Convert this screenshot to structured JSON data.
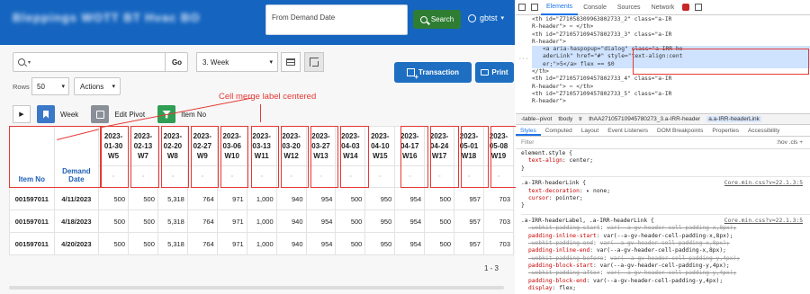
{
  "app": {
    "title": "Bleppings WOTT BT Hvac BO",
    "demand_input_placeholder": "From Demand Date",
    "search_label": "Search",
    "user_name": "gbtst"
  },
  "toolbar": {
    "go_label": "Go",
    "report_select_value": "3. Week",
    "transaction_label": "Transaction",
    "print_label": "Print",
    "rows_label": "Rows",
    "rows_value": "50",
    "actions_label": "Actions"
  },
  "annotation": "Cell merge label centered",
  "controls": {
    "week_label": "Week",
    "edit_pivot_label": "Edit Pivot",
    "item_no_label": "Item No"
  },
  "table": {
    "stub_headers": [
      "Item No",
      "Demand Date"
    ],
    "week_headers": [
      [
        "2023-",
        "01-30",
        "W5"
      ],
      [
        "2023-",
        "02-13",
        "W7"
      ],
      [
        "2023-",
        "02-20",
        "W8"
      ],
      [
        "2023-",
        "02-27",
        "W9"
      ],
      [
        "2023-",
        "03-06",
        "W10"
      ],
      [
        "2023-",
        "03-13",
        "W11"
      ],
      [
        "2023-",
        "03-20",
        "W12"
      ],
      [
        "2023-",
        "03-27",
        "W13"
      ],
      [
        "2023-",
        "04-03",
        "W14"
      ],
      [
        "2023-",
        "04-10",
        "W15"
      ],
      [
        "2023-",
        "04-17",
        "W16"
      ],
      [
        "2023-",
        "04-24",
        "W17"
      ],
      [
        "2023-",
        "05-01",
        "W18"
      ],
      [
        "2023-",
        "05-08",
        "W19"
      ]
    ],
    "rows": [
      {
        "item": "001597011",
        "date": "4/11/2023",
        "values": [
          "500",
          "500",
          "5,318",
          "764",
          "971",
          "1,000",
          "940",
          "954",
          "500",
          "950",
          "954",
          "500",
          "957",
          "703"
        ]
      },
      {
        "item": "001597011",
        "date": "4/18/2023",
        "values": [
          "500",
          "500",
          "5,318",
          "764",
          "971",
          "1,000",
          "940",
          "954",
          "500",
          "950",
          "954",
          "500",
          "957",
          "703"
        ]
      },
      {
        "item": "001597011",
        "date": "4/20/2023",
        "values": [
          "500",
          "500",
          "5,318",
          "764",
          "971",
          "1,000",
          "940",
          "954",
          "500",
          "950",
          "954",
          "500",
          "957",
          "703"
        ]
      }
    ],
    "pager": "1 - 3"
  },
  "devtools": {
    "tabs": [
      "Elements",
      "Console",
      "Sources",
      "Network"
    ],
    "elements_lines": [
      {
        "indent": 0,
        "text": "<th id=\"Z71058309963802733_2\" class=\"a-IR"
      },
      {
        "indent": 0,
        "text": "R-header\"> ⋯ </th>"
      },
      {
        "indent": 0,
        "text": "<th id=\"Z71057109457802733_3\" class=\"a-IR"
      },
      {
        "indent": 0,
        "text": "R-header\">"
      },
      {
        "indent": 1,
        "text": "<a aria-haspopup=\"dialog\" class=\"a-IRR-he"
      },
      {
        "indent": 1,
        "text": "aderLink\" href=\"#\" style=\"text-align:cent"
      },
      {
        "indent": 1,
        "text": "er;\">5</a> flex == $0"
      },
      {
        "indent": 0,
        "text": "</th>"
      },
      {
        "indent": 0,
        "text": "<th id=\"Z71057109457802733_4\" class=\"a-IR"
      },
      {
        "indent": 0,
        "text": "R-header\"> ⋯ </th>"
      },
      {
        "indent": 0,
        "text": "<th id=\"Z71057109457802733_5\" class=\"a-IR"
      },
      {
        "indent": 0,
        "text": "R-header\">"
      }
    ],
    "breadcrumbs": [
      "-table--pivot",
      "tbody",
      "tr",
      "thAA27105710945780273_3.a-IRR-header"
    ],
    "breadcrumb_last": "a.a-IRR-headerLink",
    "pane_tabs": [
      "Styles",
      "Computed",
      "Layout",
      "Event Listeners",
      "DOM Breakpoints",
      "Properties",
      "Accessibility"
    ],
    "filter_placeholder": "Filter",
    "filter_tools": ":hov  .cls  +",
    "styles": [
      {
        "type": "sel",
        "text": "element.style {"
      },
      {
        "type": "decl",
        "prop": "text-align",
        "value": "center;"
      },
      {
        "type": "sel",
        "text": "}"
      },
      {
        "type": "gap"
      },
      {
        "type": "sel",
        "text": ".a-IRR-headerLink {",
        "src": "Core.min.css?v=22.1.3:5"
      },
      {
        "type": "decl",
        "prop": "text-decoration",
        "value": "▸ none;"
      },
      {
        "type": "decl",
        "prop": "cursor",
        "value": "pointer;"
      },
      {
        "type": "sel",
        "text": "}"
      },
      {
        "type": "gap"
      },
      {
        "type": "sel",
        "text": ".a-IRR-headerLabel, .a-IRR-headerLink {",
        "src": "Core.min.css?v=22.1.3:5"
      },
      {
        "type": "strike",
        "prop": "-webkit-padding-start",
        "value": "var(--a-gv-header-cell-padding-x,8px);"
      },
      {
        "type": "decl",
        "prop": "padding-inline-start",
        "value": "var(--a-gv-header-cell-padding-x,8px);"
      },
      {
        "type": "strike",
        "prop": "-webkit-padding-end",
        "value": "var(--a-gv-header-cell-padding-x,8px);"
      },
      {
        "type": "decl",
        "prop": "padding-inline-end",
        "value": "var(--a-gv-header-cell-padding-x,8px);"
      },
      {
        "type": "strike",
        "prop": "-webkit-padding-before",
        "value": "var(--a-gv-header-cell-padding-y,4px);"
      },
      {
        "type": "decl",
        "prop": "padding-block-start",
        "value": "var(--a-gv-header-cell-padding-y,4px);"
      },
      {
        "type": "strike",
        "prop": "-webkit-padding-after",
        "value": "var(--a-gv-header-cell-padding-y,4px);"
      },
      {
        "type": "decl",
        "prop": "padding-block-end",
        "value": "var(--a-gv-header-cell-padding-y,4px);"
      },
      {
        "type": "decl",
        "prop": "display",
        "value": "flex;"
      }
    ]
  }
}
